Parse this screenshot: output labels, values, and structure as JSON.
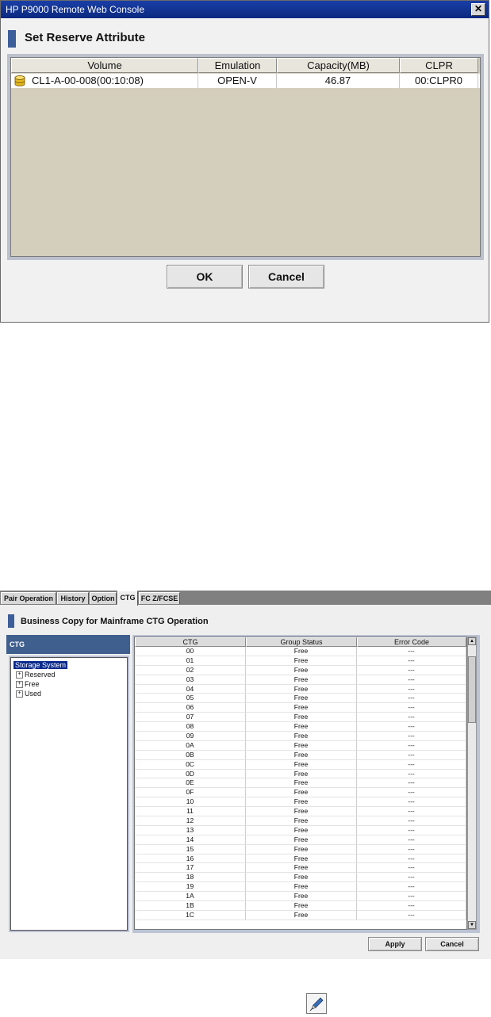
{
  "dialog": {
    "title": "HP P9000 Remote Web Console",
    "heading": "Set Reserve Attribute",
    "columns": [
      "Volume",
      "Emulation",
      "Capacity(MB)",
      "CLPR"
    ],
    "rows": [
      {
        "volume": "CL1-A-00-008(00:10:08)",
        "emulation": "OPEN-V",
        "capacity": "46.87",
        "clpr": "00:CLPR0"
      }
    ],
    "ok_label": "OK",
    "cancel_label": "Cancel"
  },
  "panel": {
    "tabs": [
      "Pair Operation",
      "History",
      "Option",
      "CTG",
      "FC Z/FCSE"
    ],
    "active_tab": "CTG",
    "heading": "Business Copy for Mainframe CTG Operation",
    "left_header": "CTG",
    "tree": {
      "root": "Storage System",
      "nodes": [
        "Reserved",
        "Free",
        "Used"
      ]
    },
    "grid": {
      "columns": [
        "CTG",
        "Group Status",
        "Error Code"
      ],
      "rows": [
        [
          "00",
          "Free",
          "---"
        ],
        [
          "01",
          "Free",
          "---"
        ],
        [
          "02",
          "Free",
          "---"
        ],
        [
          "03",
          "Free",
          "---"
        ],
        [
          "04",
          "Free",
          "---"
        ],
        [
          "05",
          "Free",
          "---"
        ],
        [
          "06",
          "Free",
          "---"
        ],
        [
          "07",
          "Free",
          "---"
        ],
        [
          "08",
          "Free",
          "---"
        ],
        [
          "09",
          "Free",
          "---"
        ],
        [
          "0A",
          "Free",
          "---"
        ],
        [
          "0B",
          "Free",
          "---"
        ],
        [
          "0C",
          "Free",
          "---"
        ],
        [
          "0D",
          "Free",
          "---"
        ],
        [
          "0E",
          "Free",
          "---"
        ],
        [
          "0F",
          "Free",
          "---"
        ],
        [
          "10",
          "Free",
          "---"
        ],
        [
          "11",
          "Free",
          "---"
        ],
        [
          "12",
          "Free",
          "---"
        ],
        [
          "13",
          "Free",
          "---"
        ],
        [
          "14",
          "Free",
          "---"
        ],
        [
          "15",
          "Free",
          "---"
        ],
        [
          "16",
          "Free",
          "---"
        ],
        [
          "17",
          "Free",
          "---"
        ],
        [
          "18",
          "Free",
          "---"
        ],
        [
          "19",
          "Free",
          "---"
        ],
        [
          "1A",
          "Free",
          "---"
        ],
        [
          "1B",
          "Free",
          "---"
        ],
        [
          "1C",
          "Free",
          "---"
        ]
      ]
    },
    "apply_label": "Apply",
    "cancel_label": "Cancel"
  },
  "icons": {
    "close": "close-icon",
    "volume": "database-icon",
    "pen": "pen-icon"
  },
  "colors": {
    "titlebar": "#0b2880",
    "accent": "#3d5f99",
    "selection": "#0a2a8c",
    "table_body": "#d4cfbd"
  }
}
